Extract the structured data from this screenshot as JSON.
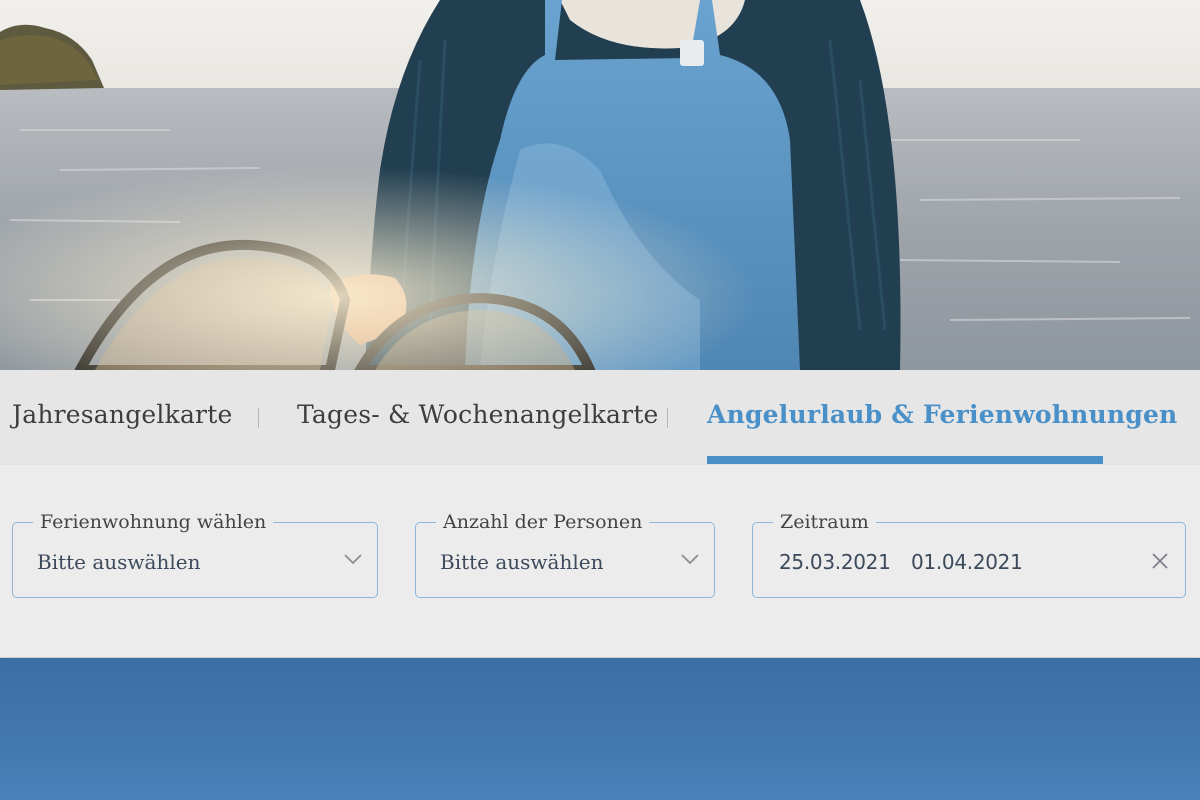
{
  "tabs": [
    {
      "label": "Jahresangelkarte",
      "active": false
    },
    {
      "label": "Tages- & Wochenangelkarte",
      "active": false
    },
    {
      "label": "Angelurlaub & Ferienwohnungen",
      "active": true
    }
  ],
  "form": {
    "apartment": {
      "legend": "Ferienwohnung wählen",
      "value": "Bitte auswählen",
      "icon": "chevron-down-icon"
    },
    "persons": {
      "legend": "Anzahl der Personen",
      "value": "Bitte auswählen",
      "icon": "chevron-down-icon"
    },
    "period": {
      "legend": "Zeitraum",
      "from": "25.03.2021",
      "to": "01.04.2021",
      "icon": "close-icon"
    }
  },
  "colors": {
    "accent": "#4a90c8",
    "field_border": "#8fb6d8",
    "footer": "#3f72a8"
  }
}
